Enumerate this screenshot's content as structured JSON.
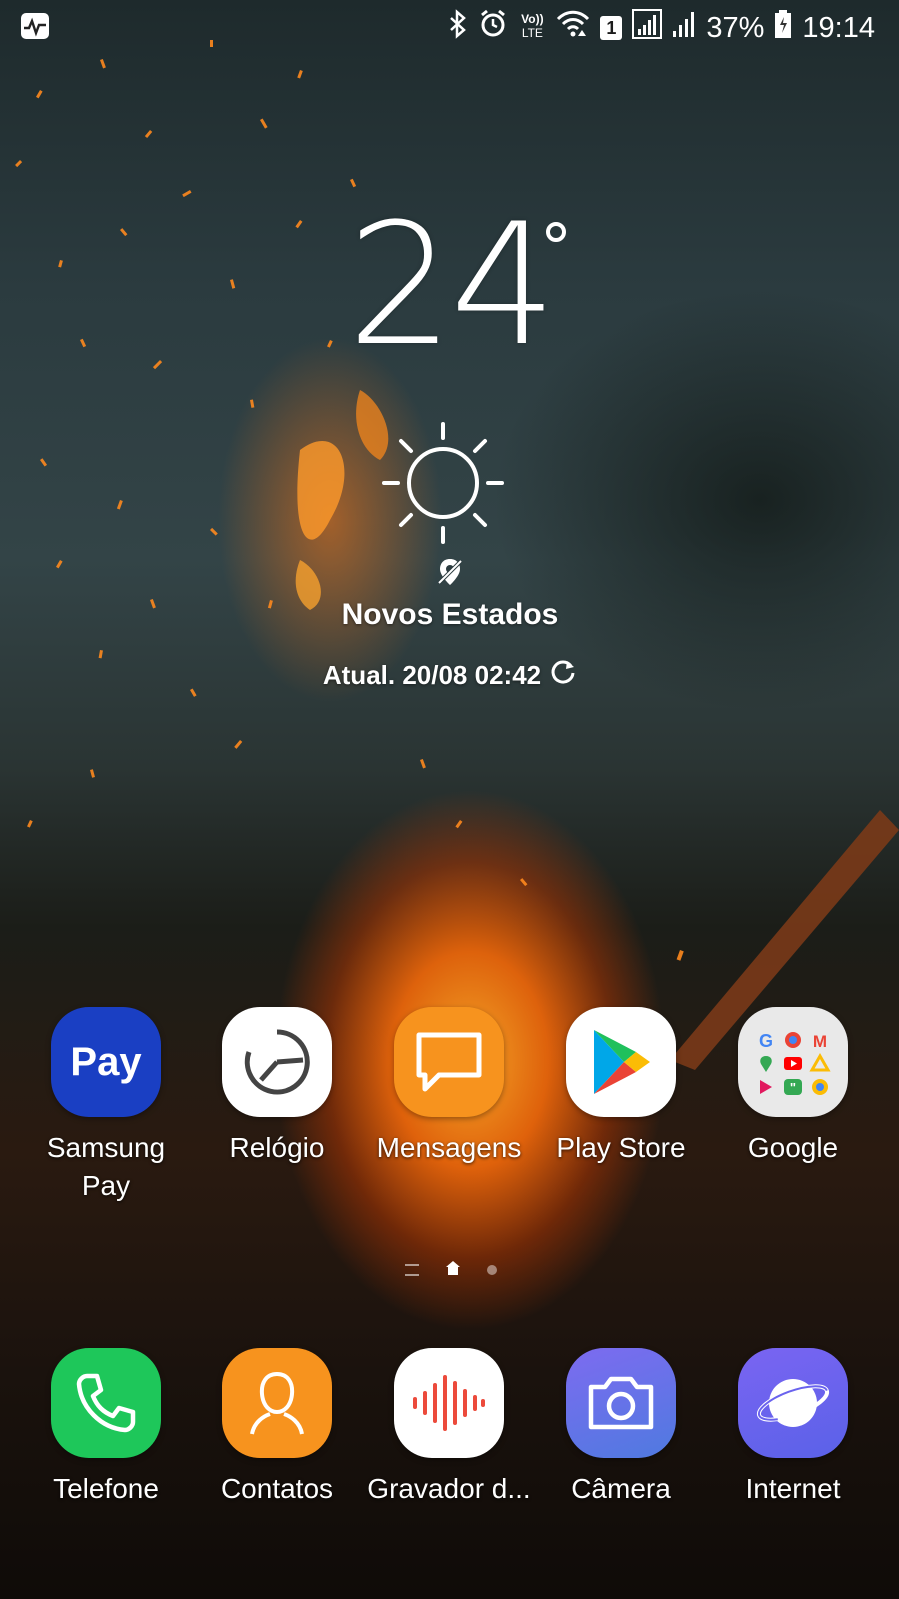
{
  "status_bar": {
    "left_icon": "health-monitor-icon",
    "icons": [
      "bluetooth-icon",
      "alarm-icon",
      "volte-icon",
      "wifi-icon",
      "sim-1-icon",
      "signal-icon",
      "signal-icon"
    ],
    "sim_badge": "1",
    "volte_top": "Vo))",
    "volte_bottom": "LTE",
    "battery_percent": "37%",
    "battery_icon": "battery-icon",
    "time": "19:14"
  },
  "weather": {
    "temperature": "24",
    "condition_icon": "sun-icon",
    "location_icon": "location-off-icon",
    "city": "Novos Estados",
    "updated": "Atual. 20/08 02:42",
    "refresh_icon": "refresh-icon"
  },
  "home_apps": [
    {
      "label": "Samsung Pay",
      "icon": "samsung-pay-icon",
      "icon_text": "Pay",
      "color": "#1a3fc3"
    },
    {
      "label": "Relógio",
      "icon": "clock-icon",
      "color": "#ffffff"
    },
    {
      "label": "Mensagens",
      "icon": "messages-icon",
      "color": "#f7931e"
    },
    {
      "label": "Play Store",
      "icon": "play-store-icon",
      "color": "#ffffff"
    },
    {
      "label": "Google",
      "icon": "google-folder-icon",
      "color": "#e9e9e9"
    }
  ],
  "page_indicator": {
    "pages": 3,
    "current": 2
  },
  "dock_apps": [
    {
      "label": "Telefone",
      "icon": "phone-icon",
      "color": "#1ec75a"
    },
    {
      "label": "Contatos",
      "icon": "contacts-icon",
      "color": "#f7931e"
    },
    {
      "label": "Gravador d...",
      "icon": "voice-recorder-icon",
      "color": "#ffffff"
    },
    {
      "label": "Câmera",
      "icon": "camera-icon",
      "color": "#6e72e8"
    },
    {
      "label": "Internet",
      "icon": "internet-icon",
      "color": "#6c6cf0"
    }
  ]
}
